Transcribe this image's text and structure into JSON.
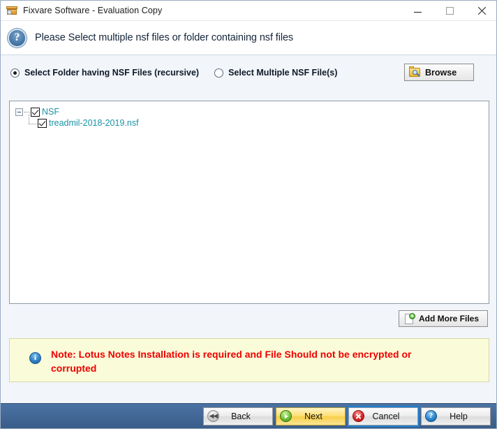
{
  "window": {
    "title": "Fixvare Software - Evaluation Copy",
    "app_icon": "package-disc-icon",
    "minimize_label": "Minimize",
    "maximize_label": "Maximize",
    "close_label": "Close"
  },
  "header": {
    "icon": "question-mark-icon",
    "instruction": "Please Select multiple nsf files or folder containing nsf files"
  },
  "options": {
    "folder_radio": {
      "label": "Select Folder having NSF Files (recursive)",
      "selected": true
    },
    "files_radio": {
      "label": "Select Multiple NSF File(s)",
      "selected": false
    },
    "browse_button": {
      "label": "Browse",
      "icon": "folder-search-icon"
    }
  },
  "tree": {
    "root": {
      "label": "NSF",
      "checked": true,
      "expanded": true
    },
    "children": [
      {
        "label": "treadmil-2018-2019.nsf",
        "checked": true
      }
    ]
  },
  "add_more": {
    "label": "Add More Files",
    "icon": "page-add-icon"
  },
  "note": {
    "icon": "info-icon",
    "icon_glyph": "i",
    "text": "Note: Lotus Notes Installation is required and File Should not be encrypted or corrupted",
    "color": "#ef0000",
    "background": "#fafbd8"
  },
  "footer": {
    "buttons": [
      {
        "label": "Back",
        "icon": "rewind-icon",
        "state": "normal"
      },
      {
        "label": "Next",
        "icon": "play-icon",
        "state": "highlight"
      },
      {
        "label": "Cancel",
        "icon": "x-circle-icon",
        "state": "focused"
      },
      {
        "label": "Help",
        "icon": "question-circle-icon",
        "state": "normal"
      }
    ],
    "bar_color": "#4b73a4"
  }
}
